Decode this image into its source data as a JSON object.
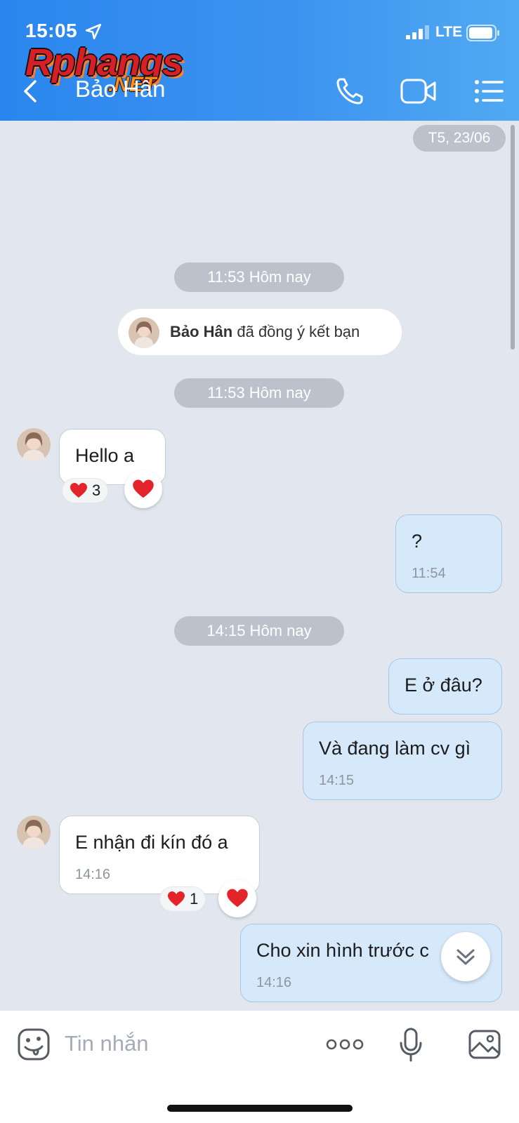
{
  "status_bar": {
    "time": "15:05",
    "network": "LTE"
  },
  "watermark": {
    "main": "Rphangs",
    "suffix": ".NET"
  },
  "header": {
    "title": "Bảo Hân"
  },
  "chat": {
    "date_pill": "T5, 23/06",
    "separators": [
      "11:53 Hôm nay",
      "11:53 Hôm nay",
      "14:15 Hôm nay"
    ],
    "system_notice": {
      "name": "Bảo Hân",
      "text": " đã đồng ý kết bạn"
    },
    "messages": [
      {
        "side": "in",
        "text": "Hello a",
        "time": "",
        "reaction_count": "3"
      },
      {
        "side": "out",
        "text": "?",
        "time": "11:54"
      },
      {
        "side": "out",
        "text": "E ở đâu?",
        "time": ""
      },
      {
        "side": "out",
        "text": "Và đang làm cv gì",
        "time": "14:15"
      },
      {
        "side": "in",
        "text": "E nhận đi kín đó a",
        "time": "14:16",
        "reaction_count": "1"
      },
      {
        "side": "out",
        "text": "Cho xin hình trước c",
        "time": "14:16"
      }
    ]
  },
  "input": {
    "placeholder": "Tin nhắn"
  },
  "colors": {
    "header": "#2a86ee",
    "bubble_out": "#d6e9fa",
    "heart": "#e3242b"
  },
  "icons": [
    "location-arrow-icon",
    "signal-icon",
    "battery-icon",
    "back-icon",
    "phone-icon",
    "video-call-icon",
    "menu-icon",
    "heart-icon",
    "chevron-double-down-icon",
    "sticker-icon",
    "more-icon",
    "mic-icon",
    "image-icon"
  ]
}
